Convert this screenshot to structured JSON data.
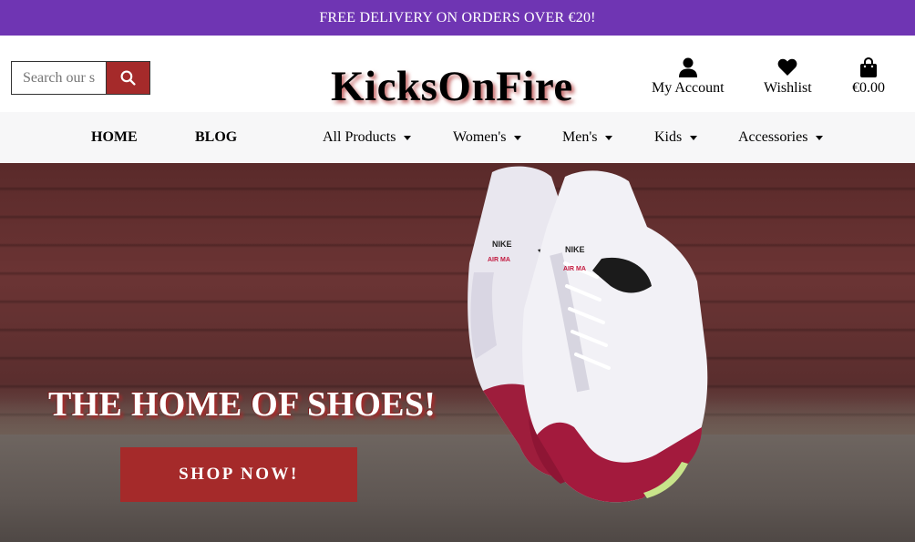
{
  "banner": {
    "text": "FREE DELIVERY ON ORDERS OVER €20!"
  },
  "search": {
    "placeholder": "Search our site"
  },
  "logo": {
    "text": "KicksOnFire"
  },
  "account": {
    "my_account_label": "My Account",
    "wishlist_label": "Wishlist",
    "cart_total": "€0.00"
  },
  "nav": {
    "home": "HOME",
    "blog": "BLOG",
    "all_products": "All Products",
    "womens": "Women's",
    "mens": "Men's",
    "kids": "Kids",
    "accessories": "Accessories"
  },
  "hero": {
    "title": "THE HOME OF SHOES!",
    "cta": "SHOP NOW!",
    "shoe_brand": "NIKE",
    "shoe_model": "AIR MA"
  },
  "colors": {
    "banner": "#6f35b3",
    "accent": "#a52a2a",
    "nav_bg": "#f7f7f8"
  }
}
